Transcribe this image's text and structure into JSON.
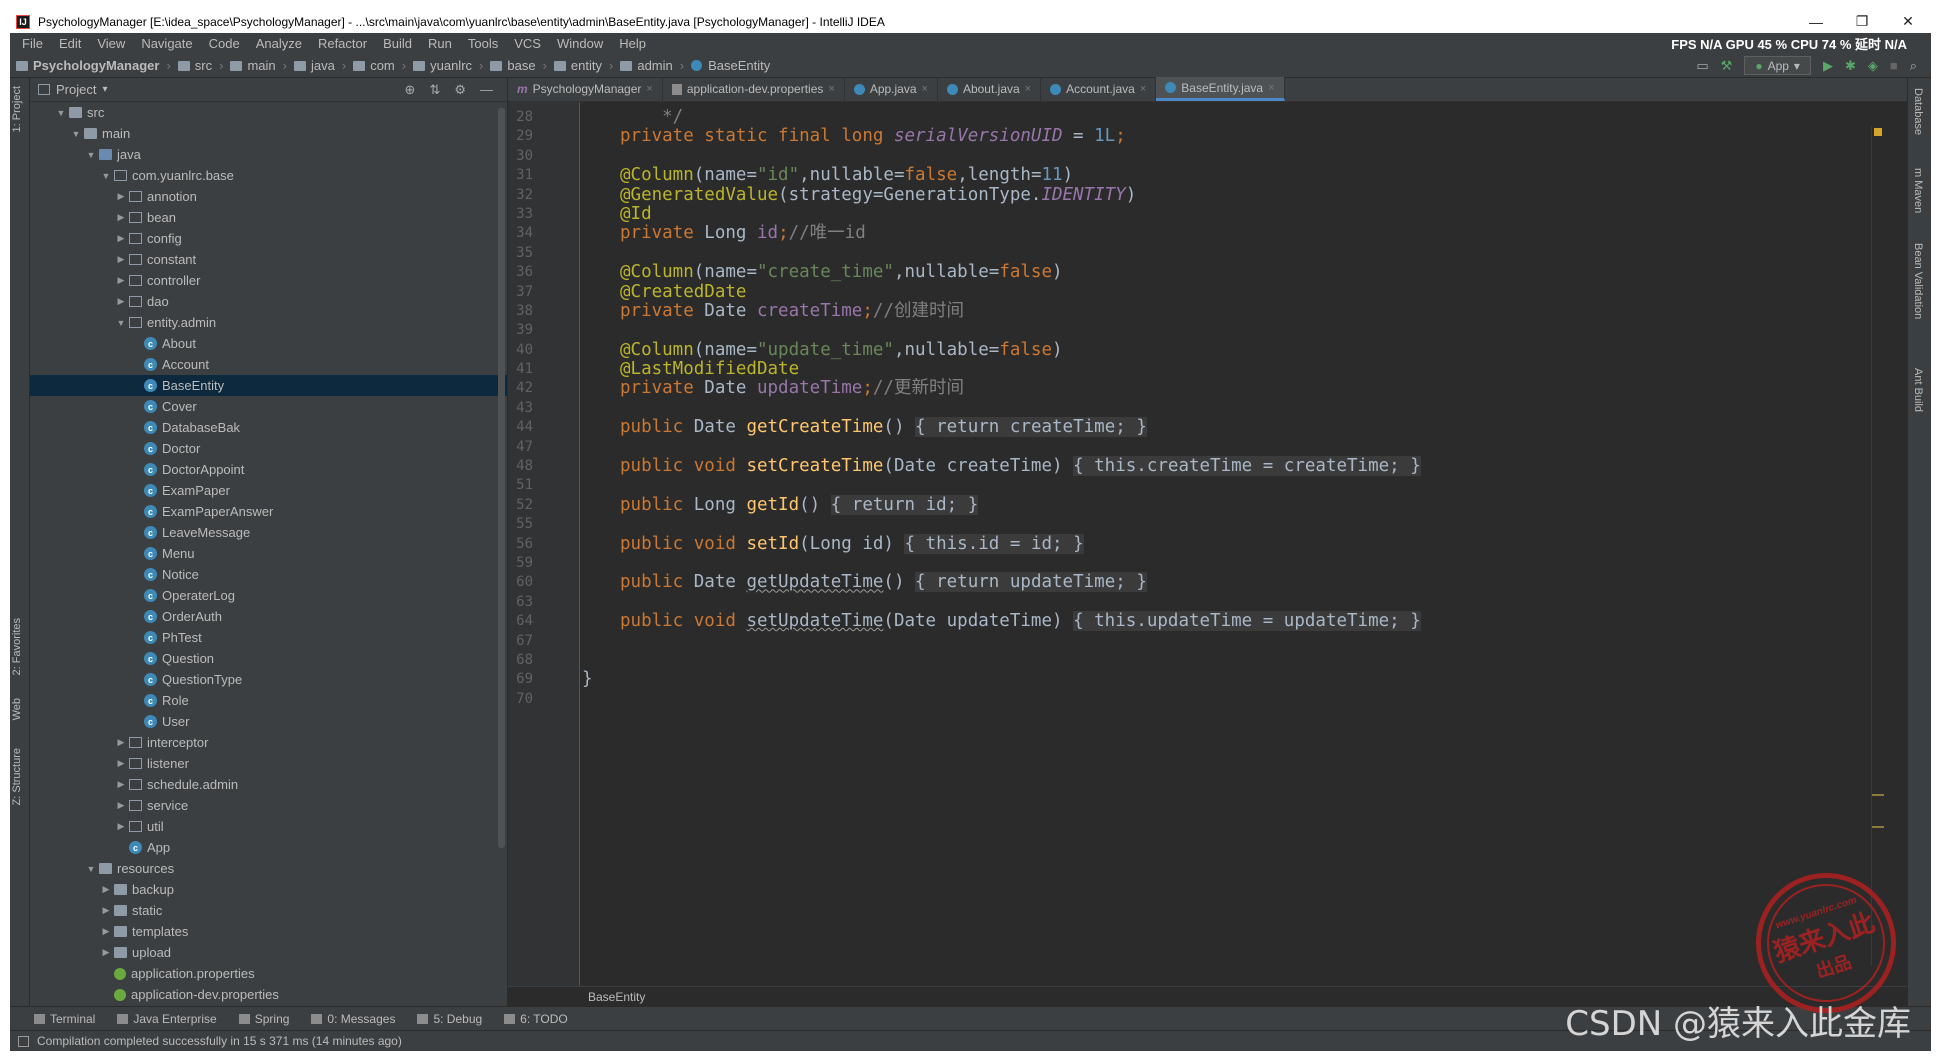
{
  "window": {
    "title": "PsychologyManager [E:\\idea_space\\PsychologyManager] - ...\\src\\main\\java\\com\\yuanlrc\\base\\entity\\admin\\BaseEntity.java [PsychologyManager] - IntelliJ IDEA",
    "app_icon": "IJ",
    "minimize": "—",
    "maximize": "❐",
    "close": "✕"
  },
  "menu": {
    "items": [
      "File",
      "Edit",
      "View",
      "Navigate",
      "Code",
      "Analyze",
      "Refactor",
      "Build",
      "Run",
      "Tools",
      "VCS",
      "Window",
      "Help"
    ],
    "stats": "FPS  N/A  GPU  45 %  CPU  74 %  延时  N/A"
  },
  "navbar": {
    "crumbs": [
      "PsychologyManager",
      "src",
      "main",
      "java",
      "com",
      "yuanlrc",
      "base",
      "entity",
      "admin",
      "BaseEntity"
    ],
    "run_config": "App"
  },
  "left_strip": {
    "project": "1: Project",
    "favorites": "2: Favorites",
    "web": "Web",
    "structure": "Z: Structure"
  },
  "project_panel": {
    "title": "Project",
    "tree": [
      {
        "label": "src",
        "depth": 1,
        "type": "folder",
        "open": true
      },
      {
        "label": "main",
        "depth": 2,
        "type": "folder",
        "open": true
      },
      {
        "label": "java",
        "depth": 3,
        "type": "srcfolder",
        "open": true
      },
      {
        "label": "com.yuanlrc.base",
        "depth": 4,
        "type": "pkg",
        "open": true
      },
      {
        "label": "annotion",
        "depth": 5,
        "type": "pkg",
        "open": false
      },
      {
        "label": "bean",
        "depth": 5,
        "type": "pkg",
        "open": false
      },
      {
        "label": "config",
        "depth": 5,
        "type": "pkg",
        "open": false
      },
      {
        "label": "constant",
        "depth": 5,
        "type": "pkg",
        "open": false
      },
      {
        "label": "controller",
        "depth": 5,
        "type": "pkg",
        "open": false
      },
      {
        "label": "dao",
        "depth": 5,
        "type": "pkg",
        "open": false
      },
      {
        "label": "entity.admin",
        "depth": 5,
        "type": "pkg",
        "open": true
      },
      {
        "label": "About",
        "depth": 6,
        "type": "cls"
      },
      {
        "label": "Account",
        "depth": 6,
        "type": "cls"
      },
      {
        "label": "BaseEntity",
        "depth": 6,
        "type": "cls",
        "selected": true
      },
      {
        "label": "Cover",
        "depth": 6,
        "type": "cls"
      },
      {
        "label": "DatabaseBak",
        "depth": 6,
        "type": "cls"
      },
      {
        "label": "Doctor",
        "depth": 6,
        "type": "cls"
      },
      {
        "label": "DoctorAppoint",
        "depth": 6,
        "type": "cls"
      },
      {
        "label": "ExamPaper",
        "depth": 6,
        "type": "cls"
      },
      {
        "label": "ExamPaperAnswer",
        "depth": 6,
        "type": "cls"
      },
      {
        "label": "LeaveMessage",
        "depth": 6,
        "type": "cls"
      },
      {
        "label": "Menu",
        "depth": 6,
        "type": "cls"
      },
      {
        "label": "Notice",
        "depth": 6,
        "type": "cls"
      },
      {
        "label": "OperaterLog",
        "depth": 6,
        "type": "cls"
      },
      {
        "label": "OrderAuth",
        "depth": 6,
        "type": "cls"
      },
      {
        "label": "PhTest",
        "depth": 6,
        "type": "cls"
      },
      {
        "label": "Question",
        "depth": 6,
        "type": "cls"
      },
      {
        "label": "QuestionType",
        "depth": 6,
        "type": "cls"
      },
      {
        "label": "Role",
        "depth": 6,
        "type": "cls"
      },
      {
        "label": "User",
        "depth": 6,
        "type": "cls"
      },
      {
        "label": "interceptor",
        "depth": 5,
        "type": "pkg",
        "open": false
      },
      {
        "label": "listener",
        "depth": 5,
        "type": "pkg",
        "open": false
      },
      {
        "label": "schedule.admin",
        "depth": 5,
        "type": "pkg",
        "open": false
      },
      {
        "label": "service",
        "depth": 5,
        "type": "pkg",
        "open": false
      },
      {
        "label": "util",
        "depth": 5,
        "type": "pkg",
        "open": false
      },
      {
        "label": "App",
        "depth": 5,
        "type": "cls"
      },
      {
        "label": "resources",
        "depth": 3,
        "type": "folder",
        "open": true
      },
      {
        "label": "backup",
        "depth": 4,
        "type": "folder",
        "open": false
      },
      {
        "label": "static",
        "depth": 4,
        "type": "folder",
        "open": false
      },
      {
        "label": "templates",
        "depth": 4,
        "type": "folder",
        "open": false
      },
      {
        "label": "upload",
        "depth": 4,
        "type": "folder",
        "open": false
      },
      {
        "label": "application.properties",
        "depth": 4,
        "type": "spring"
      },
      {
        "label": "application-dev.properties",
        "depth": 4,
        "type": "spring"
      }
    ]
  },
  "tabs": [
    {
      "label": "PsychologyManager",
      "icon": "maven-icon"
    },
    {
      "label": "application-dev.properties",
      "icon": "properties-icon"
    },
    {
      "label": "App.java",
      "icon": "class-icon"
    },
    {
      "label": "About.java",
      "icon": "class-icon"
    },
    {
      "label": "Account.java",
      "icon": "class-icon"
    },
    {
      "label": "BaseEntity.java",
      "icon": "class-icon",
      "active": true
    }
  ],
  "editor": {
    "line_numbers": [
      "28",
      "29",
      "30",
      "31",
      "32",
      "33",
      "34",
      "35",
      "36",
      "37",
      "38",
      "39",
      "40",
      "41",
      "42",
      "43",
      "44",
      "47",
      "48",
      "51",
      "52",
      "55",
      "56",
      "59",
      "60",
      "63",
      "64",
      "67",
      "68",
      "69",
      "70"
    ],
    "code_lines": [
      [
        {
          "t": "    */",
          "c": "cmt"
        }
      ],
      [
        {
          "t": "private static final long ",
          "c": "kw"
        },
        {
          "t": "serialVersionUID",
          "c": "fld it"
        },
        {
          "t": " = ",
          "c": ""
        },
        {
          "t": "1L",
          "c": "num"
        },
        {
          "t": ";",
          "c": "kw"
        }
      ],
      [],
      [
        {
          "t": "@Column",
          "c": "an"
        },
        {
          "t": "(name=",
          "c": ""
        },
        {
          "t": "\"id\"",
          "c": "str"
        },
        {
          "t": ",nullable=",
          "c": ""
        },
        {
          "t": "false",
          "c": "kw"
        },
        {
          "t": ",length=",
          "c": ""
        },
        {
          "t": "11",
          "c": "num"
        },
        {
          "t": ")",
          "c": ""
        }
      ],
      [
        {
          "t": "@GeneratedValue",
          "c": "an"
        },
        {
          "t": "(strategy=GenerationType.",
          "c": ""
        },
        {
          "t": "IDENTITY",
          "c": "fld it"
        },
        {
          "t": ")",
          "c": ""
        }
      ],
      [
        {
          "t": "@Id",
          "c": "an"
        }
      ],
      [
        {
          "t": "private ",
          "c": "kw"
        },
        {
          "t": "Long ",
          "c": ""
        },
        {
          "t": "id",
          "c": "fld"
        },
        {
          "t": ";",
          "c": "kw"
        },
        {
          "t": "//唯一id",
          "c": "cmt"
        }
      ],
      [],
      [
        {
          "t": "@Column",
          "c": "an"
        },
        {
          "t": "(name=",
          "c": ""
        },
        {
          "t": "\"create_time\"",
          "c": "str"
        },
        {
          "t": ",nullable=",
          "c": ""
        },
        {
          "t": "false",
          "c": "kw"
        },
        {
          "t": ")",
          "c": ""
        }
      ],
      [
        {
          "t": "@CreatedDate",
          "c": "an"
        }
      ],
      [
        {
          "t": "private ",
          "c": "kw"
        },
        {
          "t": "Date ",
          "c": ""
        },
        {
          "t": "createTime",
          "c": "fld"
        },
        {
          "t": ";",
          "c": "kw"
        },
        {
          "t": "//创建时间",
          "c": "cmt"
        }
      ],
      [],
      [
        {
          "t": "@Column",
          "c": "an"
        },
        {
          "t": "(name=",
          "c": ""
        },
        {
          "t": "\"update_time\"",
          "c": "str"
        },
        {
          "t": ",nullable=",
          "c": ""
        },
        {
          "t": "false",
          "c": "kw"
        },
        {
          "t": ")",
          "c": ""
        }
      ],
      [
        {
          "t": "@LastModifiedDate",
          "c": "an"
        }
      ],
      [
        {
          "t": "private ",
          "c": "kw"
        },
        {
          "t": "Date ",
          "c": ""
        },
        {
          "t": "updateTime",
          "c": "fld"
        },
        {
          "t": ";",
          "c": "kw"
        },
        {
          "t": "//更新时间",
          "c": "cmt"
        }
      ],
      [],
      [
        {
          "t": "public ",
          "c": "kw"
        },
        {
          "t": "Date ",
          "c": ""
        },
        {
          "t": "getCreateTime",
          "c": "fn"
        },
        {
          "t": "() ",
          "c": ""
        },
        {
          "t": "{ ",
          "c": "fold"
        },
        {
          "t": "return ",
          "c": "kw fold"
        },
        {
          "t": "createTime",
          "c": "fld fold"
        },
        {
          "t": "; ",
          "c": "kw fold"
        },
        {
          "t": "}",
          "c": "fold"
        }
      ],
      [],
      [
        {
          "t": "public void ",
          "c": "kw"
        },
        {
          "t": "setCreateTime",
          "c": "fn"
        },
        {
          "t": "(Date createTime) ",
          "c": ""
        },
        {
          "t": "{ ",
          "c": "fold"
        },
        {
          "t": "this",
          "c": "kw fold"
        },
        {
          "t": ".",
          "c": "fold"
        },
        {
          "t": "createTime",
          "c": "fld fold"
        },
        {
          "t": " = createTime",
          "c": "fold"
        },
        {
          "t": "; ",
          "c": "kw fold"
        },
        {
          "t": "}",
          "c": "fold"
        }
      ],
      [],
      [
        {
          "t": "public ",
          "c": "kw"
        },
        {
          "t": "Long ",
          "c": ""
        },
        {
          "t": "getId",
          "c": "fn"
        },
        {
          "t": "() ",
          "c": ""
        },
        {
          "t": "{ ",
          "c": "fold"
        },
        {
          "t": "return ",
          "c": "kw fold"
        },
        {
          "t": "id",
          "c": "fld fold"
        },
        {
          "t": "; ",
          "c": "kw fold"
        },
        {
          "t": "}",
          "c": "fold"
        }
      ],
      [],
      [
        {
          "t": "public void ",
          "c": "kw"
        },
        {
          "t": "setId",
          "c": "fn"
        },
        {
          "t": "(Long id) ",
          "c": ""
        },
        {
          "t": "{ ",
          "c": "fold"
        },
        {
          "t": "this",
          "c": "kw fold"
        },
        {
          "t": ".",
          "c": "fold"
        },
        {
          "t": "id",
          "c": "fld fold"
        },
        {
          "t": " = id",
          "c": "fold"
        },
        {
          "t": "; ",
          "c": "kw fold"
        },
        {
          "t": "}",
          "c": "fold"
        }
      ],
      [],
      [
        {
          "t": "public ",
          "c": "kw"
        },
        {
          "t": "Date ",
          "c": ""
        },
        {
          "t": "getUpdateTime",
          "c": "ul"
        },
        {
          "t": "() ",
          "c": ""
        },
        {
          "t": "{ ",
          "c": "fold"
        },
        {
          "t": "return ",
          "c": "kw fold"
        },
        {
          "t": "updateTime",
          "c": "fld fold"
        },
        {
          "t": "; ",
          "c": "kw fold"
        },
        {
          "t": "}",
          "c": "fold"
        }
      ],
      [],
      [
        {
          "t": "public void ",
          "c": "kw"
        },
        {
          "t": "setUpdateTime",
          "c": "ul"
        },
        {
          "t": "(Date updateTime) ",
          "c": ""
        },
        {
          "t": "{ ",
          "c": "fold"
        },
        {
          "t": "this",
          "c": "kw fold"
        },
        {
          "t": ".",
          "c": "fold"
        },
        {
          "t": "updateTime",
          "c": "fld fold"
        },
        {
          "t": " = updateTime",
          "c": "fold"
        },
        {
          "t": "; ",
          "c": "kw fold"
        },
        {
          "t": "}",
          "c": "fold"
        }
      ],
      [],
      [],
      [
        {
          "t": "}",
          "c": "",
          "outdent": true
        }
      ],
      []
    ],
    "breadcrumb": "BaseEntity"
  },
  "right_strip": {
    "database": "Database",
    "maven": "m Maven",
    "bean_validation": "Bean Validation",
    "ant_build": "Ant Build"
  },
  "bottom_tools": [
    {
      "label": "Terminal"
    },
    {
      "label": "Java Enterprise"
    },
    {
      "label": "Spring"
    },
    {
      "label": "0: Messages"
    },
    {
      "label": "5: Debug"
    },
    {
      "label": "6: TODO"
    }
  ],
  "status": {
    "message": "Compilation completed successfully in 15 s 371 ms (14 minutes ago)"
  },
  "watermark": {
    "text": "CSDN @猿来入此金库"
  },
  "stamp": {
    "url": "www.yuanlrc.com",
    "main": "猿来入此",
    "sub": "出品"
  },
  "colors": {
    "background": "#2b2b2b",
    "panel": "#3c3f41",
    "keyword": "#cc7832",
    "annotation": "#bbb529",
    "string": "#6a8759",
    "number": "#6897bb",
    "field": "#9876aa",
    "comment": "#808080",
    "method": "#ffc66d",
    "selection": "#0d293e"
  }
}
